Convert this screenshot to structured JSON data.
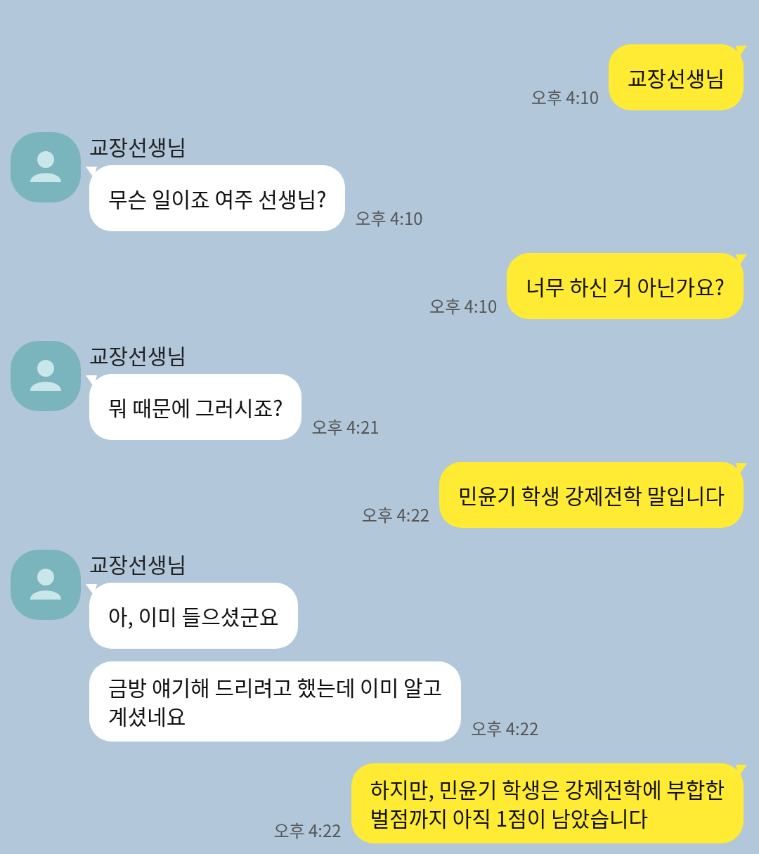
{
  "messages": [
    {
      "kind": "sent",
      "text": "교장선생님",
      "time": "오후 4:10"
    },
    {
      "kind": "received",
      "sender": "교장선생님",
      "bubbles": [
        {
          "text": "무슨 일이죠 여주 선생님?",
          "time": "오후 4:10"
        }
      ]
    },
    {
      "kind": "sent",
      "text": "너무 하신 거 아닌가요?",
      "time": "오후 4:10"
    },
    {
      "kind": "received",
      "sender": "교장선생님",
      "bubbles": [
        {
          "text": "뭐 때문에 그러시죠?",
          "time": "오후 4:21"
        }
      ]
    },
    {
      "kind": "sent",
      "text": "민윤기 학생 강제전학 말입니다",
      "time": "오후 4:22"
    },
    {
      "kind": "received",
      "sender": "교장선생님",
      "bubbles": [
        {
          "text": "아, 이미 들으셨군요"
        },
        {
          "text": "금방 얘기해 드리려고 했는데 이미 알고\n계셨네요",
          "time": "오후 4:22"
        }
      ]
    },
    {
      "kind": "sent",
      "text": "하지만, 민윤기 학생은 강제전학에 부합한\n벌점까지 아직 1점이 남았습니다",
      "time": "오후 4:22"
    }
  ]
}
